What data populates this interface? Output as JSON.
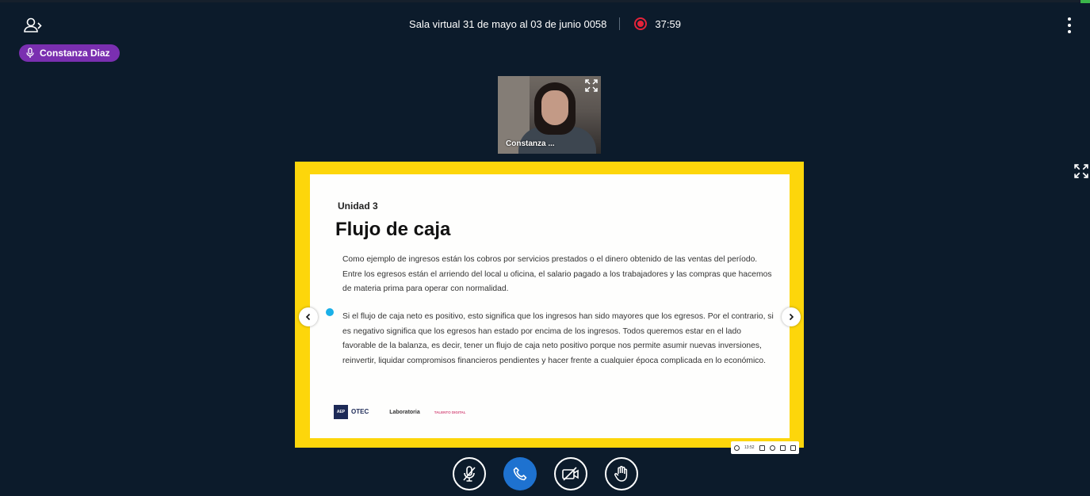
{
  "header": {
    "meeting_title": "Sala virtual 31 de mayo al 03 de junio 0058",
    "recording_time": "37:59",
    "recording_color": "#e5233a"
  },
  "talking_indicator": {
    "name": "Constanza Diaz",
    "color": "#7a2fb0"
  },
  "webcam": {
    "name": "Constanza ..."
  },
  "slide": {
    "unit": "Unidad 3",
    "title": "Flujo de caja",
    "paragraph1": "Como ejemplo de ingresos están los cobros por servicios prestados o el dinero obtenido de las ventas del período. Entre los egresos están el arriendo  del local u oficina, el salario pagado a los trabajadores y las compras que hacemos de materia prima para operar con normalidad.",
    "paragraph2": "Si el flujo de caja neto es positivo, esto significa que los ingresos han sido mayores que los egresos. Por el contrario, si es negativo significa que los egresos han estado por encima de los ingresos. Todos queremos estar en el lado favorable de la balanza, es decir, tener un flujo de caja neto positivo porque nos permite asumir nuevas inversiones, reinvertir, liquidar compromisos financieros pendientes y hacer frente a cualquier época complicada en lo económico.",
    "logos": {
      "aep": "AEP",
      "otec": "OTEC",
      "laboratoria": "Laboratoria",
      "talento": "TALENTO DIGITAL"
    },
    "frame_color": "#fdd60b",
    "mini_toolbar_time": "13:52"
  },
  "controls": {
    "buttons": [
      {
        "name": "mute-button",
        "icon": "microphone-off-icon"
      },
      {
        "name": "leave-audio-button",
        "icon": "phone-icon"
      },
      {
        "name": "webcam-button",
        "icon": "camera-off-icon"
      },
      {
        "name": "raise-hand-button",
        "icon": "hand-icon"
      }
    ],
    "accent": "#1e72d0"
  }
}
